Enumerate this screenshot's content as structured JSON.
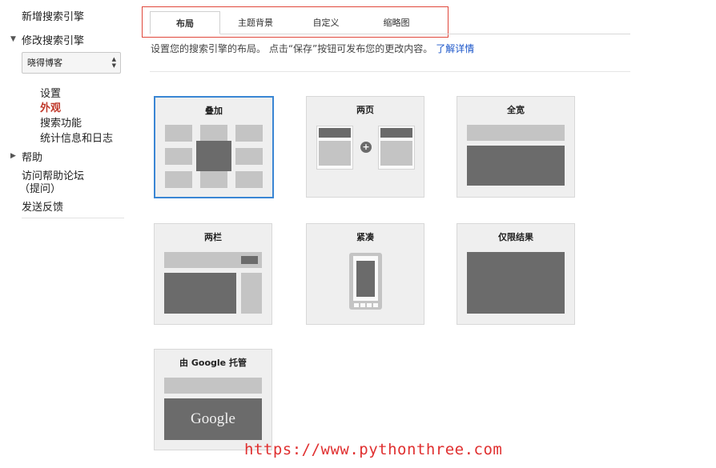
{
  "sidebar": {
    "new_engine": "新增搜索引擎",
    "edit_engine": "修改搜索引擎",
    "selected_engine": "晓得博客",
    "sub_items": [
      "设置",
      "外观",
      "搜索功能",
      "统计信息和日志"
    ],
    "help": "帮助",
    "forum_line1": "访问帮助论坛",
    "forum_line2": "（提问）",
    "feedback": "发送反馈"
  },
  "tabs": [
    "布局",
    "主题背景",
    "自定义",
    "缩略图"
  ],
  "active_tab": "布局",
  "description": {
    "text": "设置您的搜索引擎的布局。 点击“保存”按钮可发布您的更改内容。",
    "link": "了解详情"
  },
  "layouts": [
    "叠加",
    "两页",
    "全宽",
    "两栏",
    "紧凑",
    "仅限结果",
    "由 Google 托管"
  ],
  "selected_layout": "叠加",
  "google_logo": "Google",
  "watermark": "https://www.pythonthree.com",
  "colors": {
    "accent_link": "#1a55c9",
    "active_nav": "#c0392b",
    "selected_border": "#3a86d4",
    "highlight_box": "#e0473b"
  }
}
